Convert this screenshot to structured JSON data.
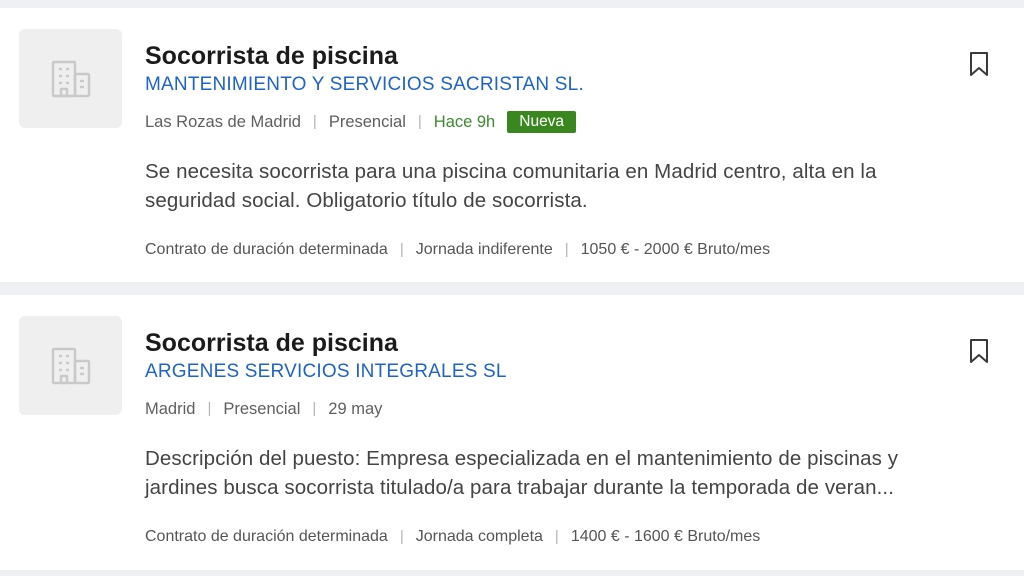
{
  "colors": {
    "title": "#1b1b1b",
    "company_link": "#1f63c4",
    "new_text": "#3d8a2e",
    "new_badge_bg": "#3b871f",
    "card_bg": "#ffffff",
    "page_bg": "#eef0f4",
    "logo_placeholder_bg": "#efefef"
  },
  "jobs": [
    {
      "logo_icon": "building-icon",
      "title": "Socorrista de piscina",
      "company": "MANTENIMIENTO Y SERVICIOS SACRISTAN SL.",
      "location": "Las Rozas de Madrid",
      "modality": "Presencial",
      "posted": "Hace 9h",
      "badge": "Nueva",
      "description_line1": "Se necesita socorrista para una piscina comunitaria en Madrid centro, alta en la",
      "description_line2": "seguridad social. Obligatorio título de socorrista.",
      "contract": "Contrato de duración determinada",
      "schedule": "Jornada indiferente",
      "salary": "1050 € - 2000 € Bruto/mes",
      "bookmark_icon": "bookmark-icon"
    },
    {
      "logo_icon": "building-icon",
      "title": "Socorrista de piscina",
      "company": "ARGENES SERVICIOS INTEGRALES SL",
      "location": "Madrid",
      "modality": "Presencial",
      "posted": "29 may",
      "description_line1": "Descripción del puesto: Empresa especializada en el mantenimiento de piscinas y",
      "description_line2": "jardines busca socorrista titulado/a para trabajar durante la temporada de veran...",
      "contract": "Contrato de duración determinada",
      "schedule": "Jornada completa",
      "salary": "1400 € - 1600 € Bruto/mes",
      "bookmark_icon": "bookmark-icon"
    }
  ]
}
